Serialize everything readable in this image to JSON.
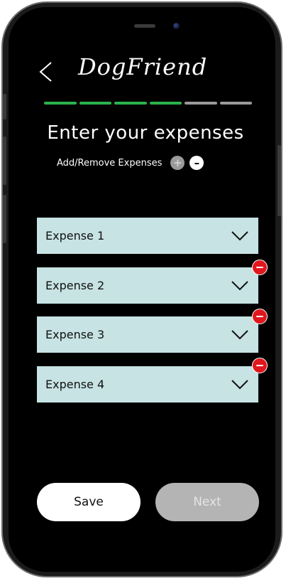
{
  "header": {
    "title": "DogFriend"
  },
  "progress": {
    "segments": 6,
    "completed": 4,
    "complete_color": "#2bb24c",
    "pending_color": "#9a9a9a"
  },
  "main": {
    "heading": "Enter your expenses",
    "add_remove_label": "Add/Remove Expenses",
    "add_icon": "plus-icon",
    "remove_icon": "minus-icon",
    "expenses": [
      {
        "label": "Expense 1",
        "removable": false
      },
      {
        "label": "Expense 2",
        "removable": true
      },
      {
        "label": "Expense 3",
        "removable": true
      },
      {
        "label": "Expense 4",
        "removable": true
      }
    ]
  },
  "footer": {
    "save_label": "Save",
    "next_label": "Next",
    "next_enabled": false
  },
  "colors": {
    "field_bg": "#c7e3e3",
    "remove_red": "#e0181e",
    "screen_bg": "#000000"
  }
}
